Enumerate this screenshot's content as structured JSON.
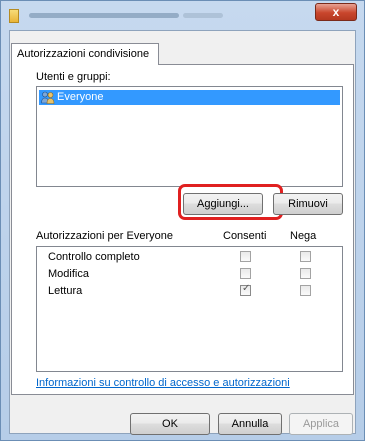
{
  "window": {
    "close_label": "x"
  },
  "tab": {
    "label": "Autorizzazioni condivisione"
  },
  "users": {
    "label": "Utenti e gruppi:",
    "items": [
      {
        "name": "Everyone",
        "selected": true,
        "icon": "users-group-icon"
      }
    ]
  },
  "user_buttons": {
    "add_label": "Aggiungi...",
    "remove_label": "Rimuovi"
  },
  "permissions": {
    "header": "Autorizzazioni per Everyone",
    "col_allow": "Consenti",
    "col_deny": "Nega",
    "rows": [
      {
        "name": "Controllo completo",
        "allow": false,
        "deny": false
      },
      {
        "name": "Modifica",
        "allow": false,
        "deny": false
      },
      {
        "name": "Lettura",
        "allow": true,
        "deny": false
      }
    ]
  },
  "link": "Informazioni su controllo di accesso e autorizzazioni",
  "footer": {
    "ok_label": "OK",
    "cancel_label": "Annulla",
    "apply_label": "Applica"
  },
  "colors": {
    "selection": "#3399ff",
    "highlight": "#e02020",
    "link": "#0066cc"
  }
}
